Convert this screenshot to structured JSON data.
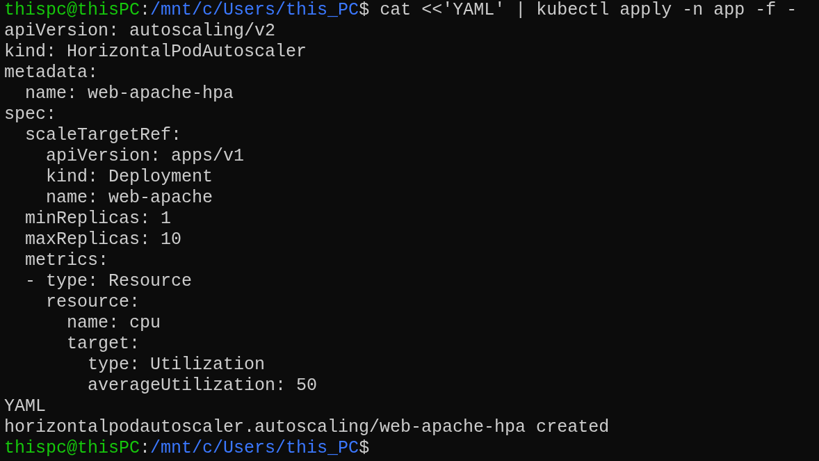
{
  "terminal": {
    "lines": [
      {
        "kind": "prompt",
        "user": "thispc@thisPC",
        "separator": ":",
        "path": "/mnt/c/Users/this_PC",
        "symbol": "$",
        "command": " cat <<'YAML' | kubectl apply -n app -f -"
      },
      {
        "kind": "output",
        "text": "apiVersion: autoscaling/v2"
      },
      {
        "kind": "output",
        "text": "kind: HorizontalPodAutoscaler"
      },
      {
        "kind": "output",
        "text": "metadata:"
      },
      {
        "kind": "output",
        "text": "  name: web-apache-hpa"
      },
      {
        "kind": "output",
        "text": "spec:"
      },
      {
        "kind": "output",
        "text": "  scaleTargetRef:"
      },
      {
        "kind": "output",
        "text": "    apiVersion: apps/v1"
      },
      {
        "kind": "output",
        "text": "    kind: Deployment"
      },
      {
        "kind": "output",
        "text": "    name: web-apache"
      },
      {
        "kind": "output",
        "text": "  minReplicas: 1"
      },
      {
        "kind": "output",
        "text": "  maxReplicas: 10"
      },
      {
        "kind": "output",
        "text": "  metrics:"
      },
      {
        "kind": "output",
        "text": "  - type: Resource"
      },
      {
        "kind": "output",
        "text": "    resource:"
      },
      {
        "kind": "output",
        "text": "      name: cpu"
      },
      {
        "kind": "output",
        "text": "      target:"
      },
      {
        "kind": "output",
        "text": "        type: Utilization"
      },
      {
        "kind": "output",
        "text": "        averageUtilization: 50"
      },
      {
        "kind": "output",
        "text": "YAML"
      },
      {
        "kind": "output",
        "text": "horizontalpodautoscaler.autoscaling/web-apache-hpa created"
      },
      {
        "kind": "prompt",
        "user": "thispc@thisPC",
        "separator": ":",
        "path": "/mnt/c/Users/this_PC",
        "symbol": "$"
      }
    ]
  }
}
